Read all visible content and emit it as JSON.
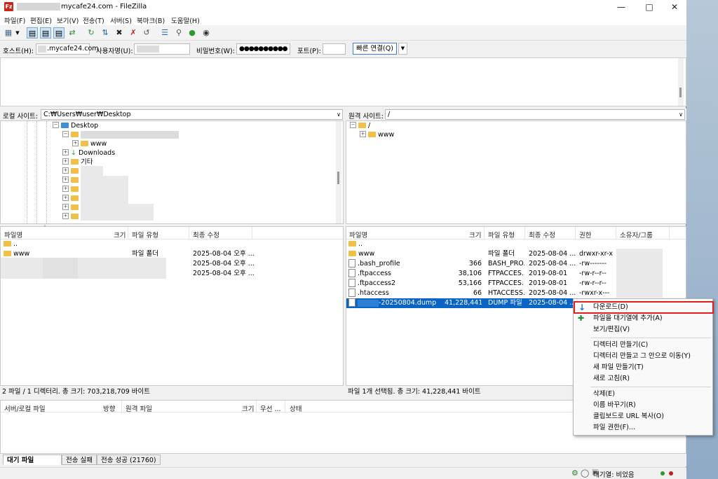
{
  "window": {
    "title_suffix": "mycafe24.com - FileZilla",
    "app_icon": "Fz"
  },
  "menu": [
    "파일(F)",
    "편집(E)",
    "보기(V)",
    "전송(T)",
    "서버(S)",
    "북마크(B)",
    "도움말(H)"
  ],
  "quickconnect": {
    "host_label": "호스트(H):",
    "host_value": ".mycafe24.com",
    "user_label": "사용자명(U):",
    "pass_label": "비밀번호(W):",
    "pass_value": "●●●●●●●●●●",
    "port_label": "포트(P):",
    "connect_label": "빠른 연결(Q)"
  },
  "local": {
    "site_label": "로컬 사이트:",
    "path": "C:₩Users₩user₩Desktop",
    "tree": {
      "desktop": "Desktop",
      "www": "www",
      "downloads": "Downloads",
      "other": "기타"
    },
    "cols": [
      "파일명",
      "크기",
      "파일 유형",
      "최종 수정"
    ],
    "rows": [
      {
        "name": "..",
        "size": "",
        "type": "",
        "modified": ""
      },
      {
        "name": "www",
        "size": "",
        "type": "파일 폴더",
        "modified": "2025-08-04 오후 ..."
      },
      {
        "name": "",
        "size": "",
        "type": "",
        "modified": "2025-08-04 오후 ..."
      },
      {
        "name": "",
        "size": "",
        "type": "",
        "modified": "2025-08-04 오후 ..."
      }
    ],
    "status": "2 파일 / 1 디렉터리. 총 크기: 703,218,709 바이트"
  },
  "remote": {
    "site_label": "원격 사이트:",
    "path": "/",
    "tree": {
      "root": "/",
      "www": "www"
    },
    "cols": [
      "파일명",
      "크기",
      "파일 유형",
      "최종 수정",
      "권한",
      "소유자/그룹"
    ],
    "rows": [
      {
        "name": "..",
        "size": "",
        "type": "",
        "modified": "",
        "perm": ""
      },
      {
        "name": "www",
        "size": "",
        "type": "파일 폴더",
        "modified": "2025-08-04 ...",
        "perm": "drwxr-xr-x"
      },
      {
        "name": ".bash_profile",
        "size": "366",
        "type": "BASH_PRO...",
        "modified": "2025-08-04 ...",
        "perm": "-rw-------"
      },
      {
        "name": ".ftpaccess",
        "size": "38,106",
        "type": "FTPACCES...",
        "modified": "2019-08-01",
        "perm": "-rw-r--r--"
      },
      {
        "name": ".ftpaccess2",
        "size": "53,166",
        "type": "FTPACCES...",
        "modified": "2019-08-01",
        "perm": "-rw-r--r--"
      },
      {
        "name": ".htaccess",
        "size": "66",
        "type": "HTACCESS...",
        "modified": "2025-08-04 ...",
        "perm": "-rwxr-x---"
      },
      {
        "name": "-20250804.dump",
        "size": "41,228,441",
        "type": "DUMP 파일",
        "modified": "2025-08-04 ...",
        "perm": ""
      }
    ],
    "status": "파일 1개 선택됨. 총 크기: 41,228,441 바이트"
  },
  "queue": {
    "cols": [
      "서버/로컬 파일",
      "방향",
      "원격 파일",
      "크기",
      "우선 ...",
      "상태"
    ],
    "tabs": [
      "대기 파일",
      "전송 실패",
      "전송 성공 (21760)"
    ]
  },
  "context_menu": {
    "items": [
      "다운로드(D)",
      "파일을 대기열에 추가(A)",
      "보기/편집(V)",
      "디렉터리 만들기(C)",
      "디렉터리 만들고 그 안으로 이동(Y)",
      "새 파일 만들기(T)",
      "새로 고침(R)",
      "삭제(E)",
      "이름 바꾸기(R)",
      "클립보드로 URL 복사(O)",
      "파일 권한(F)..."
    ]
  },
  "footer": {
    "queue_status": "대기열: 비었음"
  },
  "colors": {
    "selection": "#0a64c8",
    "highlight_box": "#e02020",
    "folder": "#f1c04b"
  }
}
